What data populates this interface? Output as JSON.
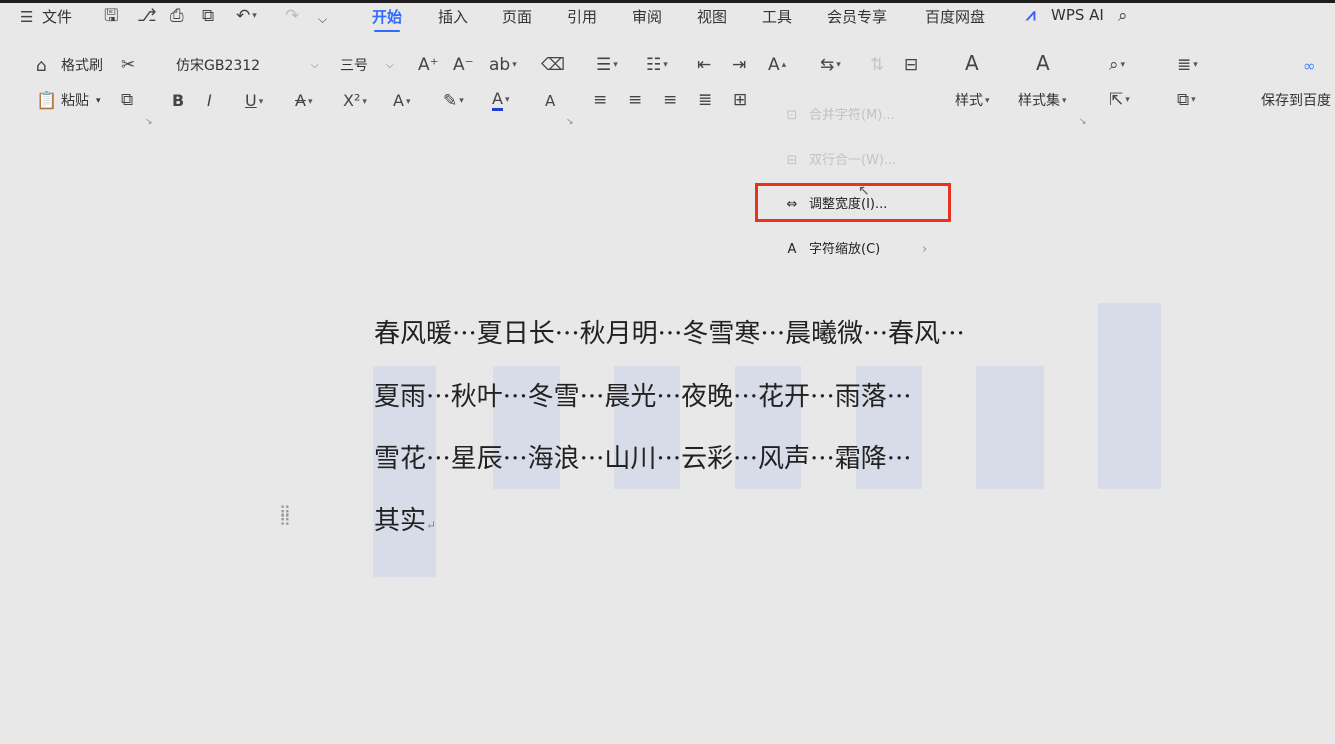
{
  "menu": {
    "file": "文件",
    "tabs": [
      "开始",
      "插入",
      "页面",
      "引用",
      "审阅",
      "视图",
      "工具",
      "会员专享",
      "百度网盘"
    ],
    "active_tab": "开始",
    "wps_ai": "WPS AI"
  },
  "ribbon": {
    "format_painter": "格式刷",
    "paste": "粘贴",
    "font_name": "仿宋GB2312",
    "font_size": "三号",
    "styles": "样式",
    "style_set": "样式集",
    "save_baidu": "保存到百度"
  },
  "context_menu": {
    "items": [
      {
        "label": "合并字符(M)...",
        "enabled": false
      },
      {
        "label": "双行合一(W)...",
        "enabled": false
      },
      {
        "label": "调整宽度(I)...",
        "enabled": true,
        "highlighted": true
      },
      {
        "label": "字符缩放(C)",
        "enabled": true,
        "submenu": true
      }
    ]
  },
  "document": {
    "lines": [
      "春风暖···夏日长···秋月明···冬雪寒···晨曦微···春风···",
      "夏雨···秋叶···冬雪···晨光···夜晚···花开···雨落···",
      "雪花···星辰···海浪···山川···云彩···风声···霜降···",
      "其实"
    ],
    "paragraph_mark": "↵"
  },
  "colors": {
    "accent": "#2f6bff",
    "highlight_border": "#e8321d",
    "selection": "#d8dce8",
    "background": "#e8e8e8"
  }
}
